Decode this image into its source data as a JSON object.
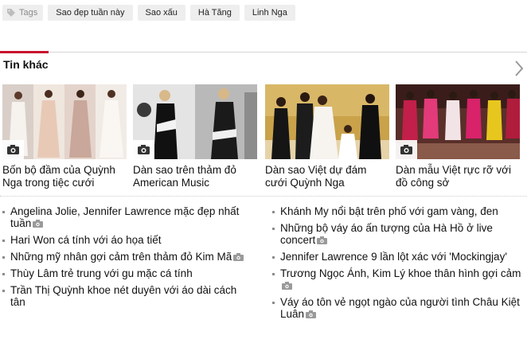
{
  "tags": {
    "label": "Tags",
    "items": [
      "Sao đẹp tuần này",
      "Sao xấu",
      "Hà Tăng",
      "Linh Nga"
    ]
  },
  "section": {
    "title": "Tin khác"
  },
  "cards": [
    {
      "title": "Bốn bộ đầm của Quỳnh Nga trong tiệc cưới"
    },
    {
      "title": "Dàn sao trên thảm đỏ American Music"
    },
    {
      "title": "Dàn sao Việt dự đám cưới Quỳnh Nga"
    },
    {
      "title": "Dàn mẫu Việt rực rỡ với đồ công sở"
    }
  ],
  "list_left": [
    {
      "text": "Angelina Jolie, Jennifer Lawrence mặc đẹp nhất tuần",
      "camera": true
    },
    {
      "text": "Hari Won cá tính với áo họa tiết",
      "camera": false
    },
    {
      "text": "Những mỹ nhân gợi cảm trên thảm đỏ Kim Mã",
      "camera": true
    },
    {
      "text": "Thùy Lâm trẻ trung với gu mặc cá tính",
      "camera": false
    },
    {
      "text": "Trần Thị Quỳnh khoe nét duyên với áo dài cách tân",
      "camera": false
    }
  ],
  "list_right": [
    {
      "text": "Khánh My nổi bật trên phố với gam vàng, đen",
      "camera": false
    },
    {
      "text": "Những bộ váy áo ấn tượng của Hà Hồ ở live concert",
      "camera": true
    },
    {
      "text": "Jennifer Lawrence 9 lần lột xác với 'Mockingjay'",
      "camera": false
    },
    {
      "text": "Trương Ngọc Ánh, Kim Lý khoe thân hình gợi cảm",
      "camera": true
    },
    {
      "text": "Váy áo tôn vẻ ngọt ngào của người tình Châu Kiệt Luân",
      "camera": true
    }
  ],
  "colors": {
    "accent": "#c8102e",
    "tag_bg": "#eeeeee",
    "rule": "#d7d7d7"
  }
}
